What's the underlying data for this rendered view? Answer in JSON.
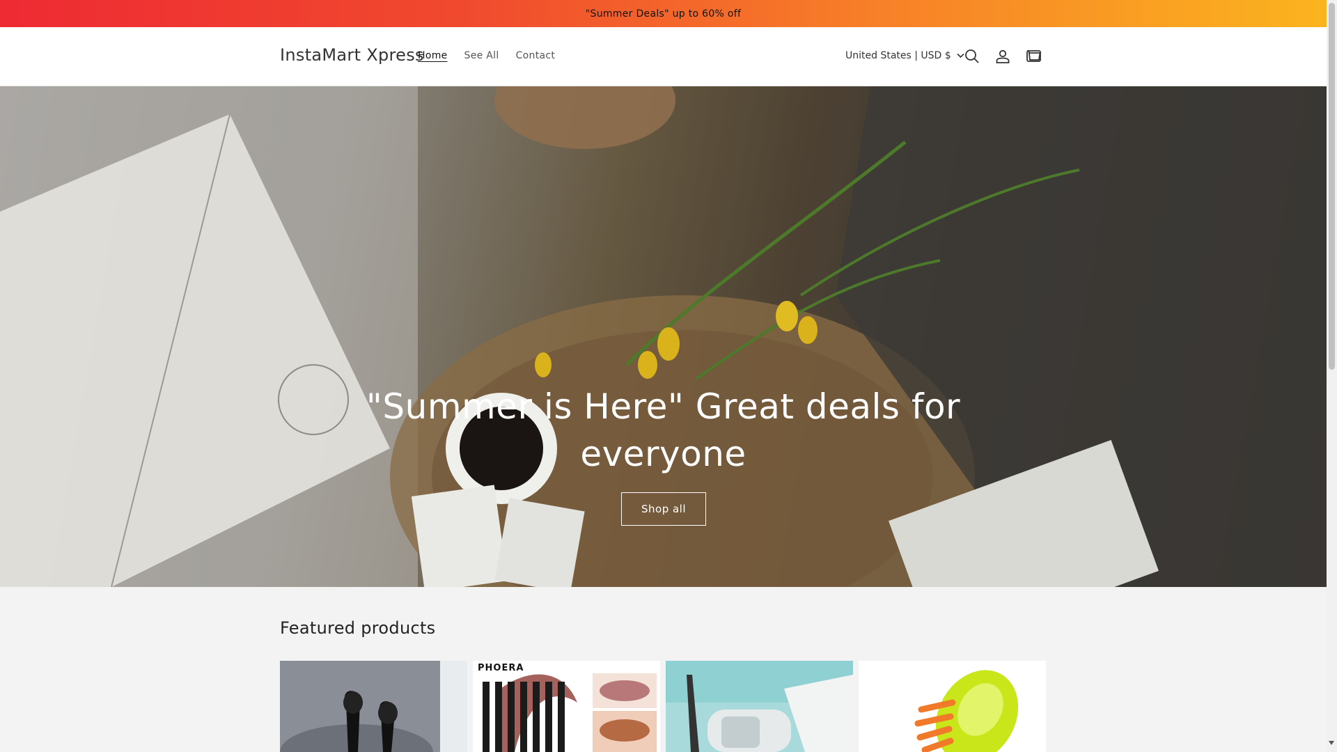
{
  "announcement": {
    "text": "\"Summer Deals\" up to 60% off"
  },
  "header": {
    "logo": "InstaMart Xpress",
    "nav": [
      {
        "label": "Home",
        "active": true
      },
      {
        "label": "See All",
        "active": false
      },
      {
        "label": "Contact",
        "active": false
      }
    ],
    "locale": "United States | USD $",
    "icons": [
      "search-icon",
      "account-icon",
      "cart-icon"
    ]
  },
  "hero": {
    "title_line1": "\"Summer is Here\" Great deals for",
    "title_line2": "everyone",
    "button": "Shop all"
  },
  "featured": {
    "title": "Featured products",
    "products": [
      {
        "image": "black wireless earbuds"
      },
      {
        "image": "PHOERA lip liner pencils",
        "brand_text": "PHOERA"
      },
      {
        "image": "handheld vacuum cleaner"
      },
      {
        "image": "pet grooming brush"
      }
    ]
  },
  "colors": {
    "accent": "#121212",
    "banner_start": "#ee2a33",
    "banner_end": "#fbb41f"
  }
}
